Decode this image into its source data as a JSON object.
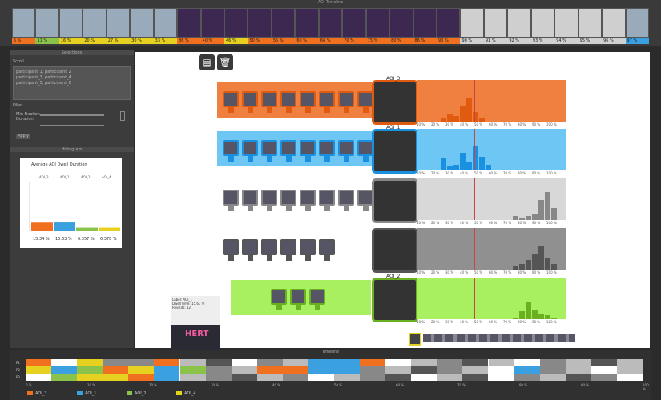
{
  "top_strip": {
    "title": "AOI Timeline",
    "thumbs": [
      {
        "label": "5 %",
        "color": "#f07020"
      },
      {
        "label": "11 %",
        "color": "#8bc34a"
      },
      {
        "label": "16 %",
        "color": "#e6d020"
      },
      {
        "label": "20 %",
        "color": "#e6d020"
      },
      {
        "label": "27 %",
        "color": "#e6d020"
      },
      {
        "label": "30 %",
        "color": "#e6d020"
      },
      {
        "label": "33 %",
        "color": "#e6d020"
      },
      {
        "label": "36 %",
        "color": "#f07020"
      },
      {
        "label": "40 %",
        "color": "#f07020"
      },
      {
        "label": "46 %",
        "color": "#e6d020"
      },
      {
        "label": "50 %",
        "color": "#f07020"
      },
      {
        "label": "55 %",
        "color": "#f07020"
      },
      {
        "label": "60 %",
        "color": "#f07020"
      },
      {
        "label": "66 %",
        "color": "#f07020"
      },
      {
        "label": "70 %",
        "color": "#f07020"
      },
      {
        "label": "75 %",
        "color": "#f07020"
      },
      {
        "label": "80 %",
        "color": "#f07020"
      },
      {
        "label": "86 %",
        "color": "#f07020"
      },
      {
        "label": "90 %",
        "color": "#f07020"
      },
      {
        "label": "90 %",
        "color": "#d0d0d0"
      },
      {
        "label": "91 %",
        "color": "#d0d0d0"
      },
      {
        "label": "92 %",
        "color": "#d0d0d0"
      },
      {
        "label": "93 %",
        "color": "#d0d0d0"
      },
      {
        "label": "94 %",
        "color": "#d0d0d0"
      },
      {
        "label": "95 %",
        "color": "#d0d0d0"
      },
      {
        "label": "96 %",
        "color": "#d0d0d0"
      },
      {
        "label": "97 %",
        "color": "#3aa0e0"
      }
    ]
  },
  "left_panel": {
    "section1_title": "Selections",
    "select_label": "Scroll",
    "text_lines": [
      "participant_1, participant_2",
      "participant_3, participant_4",
      "participant_5, participant_6"
    ],
    "filter_label": "Filter",
    "min_label": "Min Fixation",
    "dur_label": "Duration",
    "small_btn": "Apply",
    "histogram_title": "Histogram",
    "chart_title": "Average AOI Dwell Duration",
    "series": [
      "AOI_3",
      "AOI_1",
      "AOI_2",
      "AOI_4"
    ]
  },
  "chart_data": {
    "type": "bar",
    "title": "Average AOI Dwell Duration",
    "categories": [
      "AOI_3",
      "AOI_1",
      "AOI_2",
      "AOI_4"
    ],
    "values": [
      15.34,
      15.63,
      6.357,
      6.378
    ],
    "value_labels": [
      "15.34 %",
      "15.63 %",
      "6.357 %",
      "6.378 %"
    ],
    "colors": [
      "#f07020",
      "#3aa0e0",
      "#8bc34a",
      "#e6d020"
    ]
  },
  "main": {
    "rows": [
      {
        "aoi": "AOI_3",
        "color": "#f08040",
        "accent": "#e05a10",
        "thumbs": 9
      },
      {
        "aoi": "AOI_1",
        "color": "#6ec6f5",
        "accent": "#1a90e0",
        "thumbs": 8
      },
      {
        "aoi": "",
        "color": "#d8d8d8",
        "accent": "#888",
        "thumbs": 8
      },
      {
        "aoi": "",
        "color": "#909090",
        "accent": "#555",
        "thumbs": 6
      },
      {
        "aoi": "AOI_2",
        "color": "#a8f060",
        "accent": "#6ab020",
        "thumbs": 3
      }
    ],
    "ticks": [
      "10 %",
      "20 %",
      "30 %",
      "40 %",
      "50 %",
      "60 %",
      "70 %",
      "80 %",
      "90 %",
      "100 %"
    ],
    "preview_caption": "Label: AOI_1\nDwell time: 15.63 %\nRevisits: 12"
  },
  "bottom": {
    "title": "Timeline",
    "row_labels": [
      "P1",
      "P2",
      "P3"
    ],
    "ticks": [
      "0 %",
      "10 %",
      "20 %",
      "30 %",
      "40 %",
      "50 %",
      "60 %",
      "70 %",
      "80 %",
      "90 %",
      "100 %"
    ],
    "legend": [
      {
        "label": "AOI_3",
        "color": "#f07020"
      },
      {
        "label": "AOI_1",
        "color": "#3aa0e0"
      },
      {
        "label": "AOI_2",
        "color": "#8bc34a"
      },
      {
        "label": "AOI_4",
        "color": "#e6d020"
      }
    ]
  }
}
